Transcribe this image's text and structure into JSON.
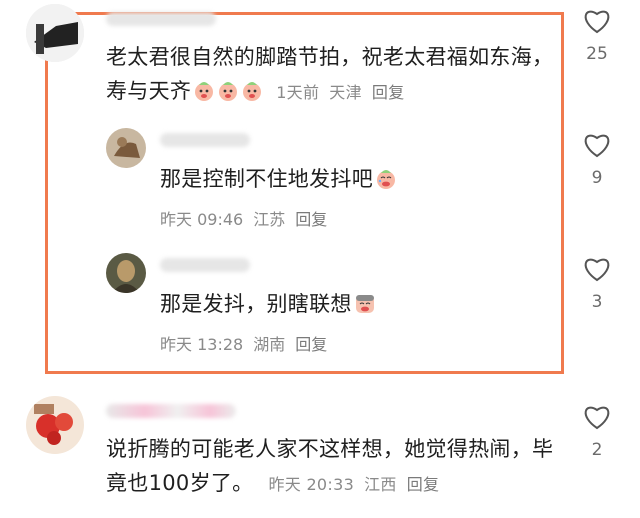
{
  "comments": [
    {
      "text": "老太君很自然的脚踏节拍，祝老太君福如东海，寿与天齐",
      "time": "1天前",
      "location": "天津",
      "reply_label": "回复",
      "likes": "25",
      "emoji": "peach-face-icon"
    },
    {
      "text": "那是控制不住地发抖吧",
      "time": "昨天 09:46",
      "location": "江苏",
      "reply_label": "回复",
      "likes": "9",
      "emoji": "peach-face-icon"
    },
    {
      "text": "那是发抖，别瞎联想",
      "time": "昨天 13:28",
      "location": "湖南",
      "reply_label": "回复",
      "likes": "3",
      "emoji": "crying-face-icon"
    },
    {
      "text": "说折腾的可能老人家不这样想，她觉得热闹，毕竟也100岁了。",
      "time": "昨天 20:33",
      "location": "江西",
      "reply_label": "回复",
      "likes": "2"
    }
  ],
  "colors": {
    "highlight_border": "#f07a4e",
    "meta_text": "#8a8a8a"
  }
}
